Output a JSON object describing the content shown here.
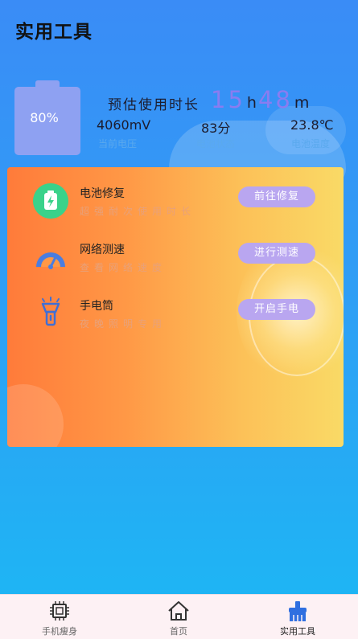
{
  "header": {
    "title": "实用工具"
  },
  "battery": {
    "percent_label": "80%",
    "estimate_label": "预估使用时长",
    "hours": "15",
    "hours_unit": "h",
    "minutes": "48",
    "minutes_unit": "m",
    "stats": [
      {
        "value": "4060mV",
        "label": "当前电压"
      },
      {
        "value": "83分",
        "label": "电池状态"
      },
      {
        "value": "23.8℃",
        "label": "电池温度"
      }
    ]
  },
  "tools": [
    {
      "title": "电池修复",
      "subtitle": "超强耐次使用时长",
      "button": "前往修复",
      "icon": "battery-repair-icon"
    },
    {
      "title": "网络测速",
      "subtitle": "查看网络速度",
      "button": "进行测速",
      "icon": "speedometer-icon"
    },
    {
      "title": "手电筒",
      "subtitle": "夜晚照明专用",
      "button": "开启手电",
      "icon": "flashlight-icon"
    }
  ],
  "tabbar": {
    "items": [
      {
        "label": "手机瘦身",
        "icon": "chip-icon"
      },
      {
        "label": "首页",
        "icon": "home-icon"
      },
      {
        "label": "实用工具",
        "icon": "brush-icon"
      }
    ],
    "active_index": 2
  },
  "colors": {
    "background_top": "#3a8cf6",
    "background_bottom": "#1cb8f4",
    "accent_purple": "#8a7cf0",
    "button_purple": "#b9a6f0",
    "card_orange": "#ff7b3a",
    "card_yellow": "#f9da66"
  }
}
